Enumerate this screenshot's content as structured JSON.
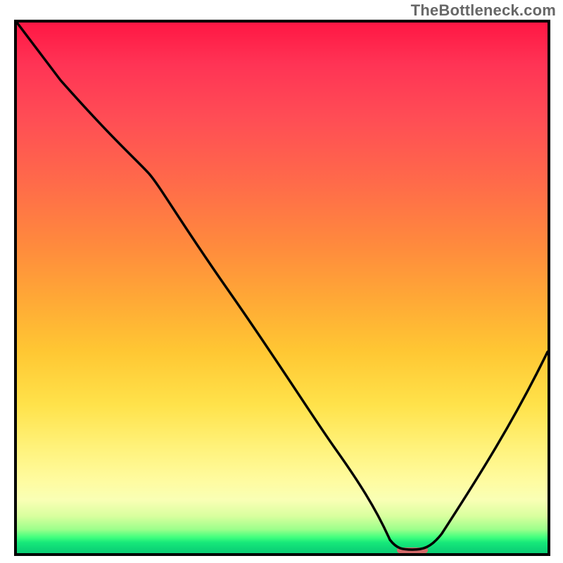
{
  "watermark": "TheBottleneck.com",
  "chart_data": {
    "type": "line",
    "title": "",
    "xlabel": "",
    "ylabel": "",
    "xlim": [
      0,
      100
    ],
    "ylim": [
      0,
      100
    ],
    "series": [
      {
        "name": "curve",
        "x": [
          0,
          8,
          22,
          30,
          40,
          50,
          60,
          66,
          70,
          73,
          76,
          80,
          90,
          100
        ],
        "values": [
          100,
          89,
          74,
          65,
          50,
          35,
          20,
          10,
          3,
          1,
          1,
          3,
          18,
          38
        ]
      }
    ],
    "marker": {
      "x_center": 74.5,
      "y": 0.5,
      "width_pct": 5.0,
      "color": "#d46a6a"
    },
    "gradient_stops": [
      {
        "pct": 0,
        "color": "#ff1744"
      },
      {
        "pct": 50,
        "color": "#ffa836"
      },
      {
        "pct": 80,
        "color": "#fff27a"
      },
      {
        "pct": 97,
        "color": "#42ff7e"
      },
      {
        "pct": 100,
        "color": "#0bce75"
      }
    ]
  }
}
